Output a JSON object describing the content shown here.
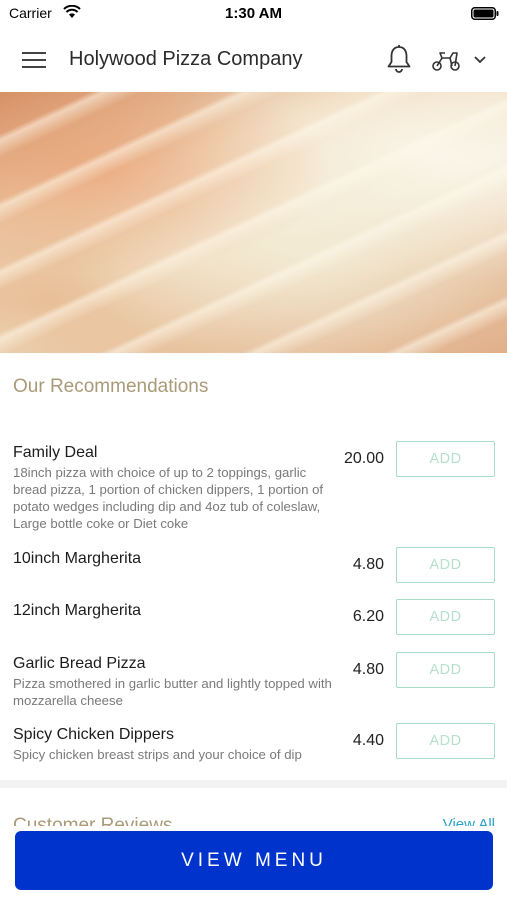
{
  "status_bar": {
    "carrier": "Carrier",
    "time": "1:30 AM"
  },
  "app_bar": {
    "title": "Holywood Pizza Company",
    "icons": [
      "menu-icon",
      "bell-icon",
      "scooter-icon",
      "chevron-down-icon"
    ]
  },
  "recommendations": {
    "title": "Our Recommendations",
    "add_label": "ADD",
    "items": [
      {
        "name": "Family Deal",
        "description": "18inch pizza with choice of up to 2 toppings, garlic bread pizza, 1 portion of chicken dippers, 1 portion of potato wedges including dip and 4oz tub of coleslaw, Large bottle coke or Diet coke",
        "price": "20.00"
      },
      {
        "name": "10inch Margherita",
        "description": "",
        "price": "4.80"
      },
      {
        "name": "12inch Margherita",
        "description": "",
        "price": "6.20"
      },
      {
        "name": "Garlic Bread Pizza",
        "description": "Pizza smothered in garlic butter and lightly topped with mozzarella cheese",
        "price": "4.80"
      },
      {
        "name": "Spicy Chicken Dippers",
        "description": "Spicy chicken breast strips and your choice of dip",
        "price": "4.40"
      }
    ]
  },
  "reviews": {
    "title": "Customer Reviews",
    "view_all": "View All"
  },
  "footer": {
    "view_menu_label": "VIEW MENU"
  },
  "colors": {
    "accent_gold": "#a99a78",
    "add_border": "#a8dcc4",
    "primary_button": "#0033cc",
    "link": "#2aa3c9"
  }
}
